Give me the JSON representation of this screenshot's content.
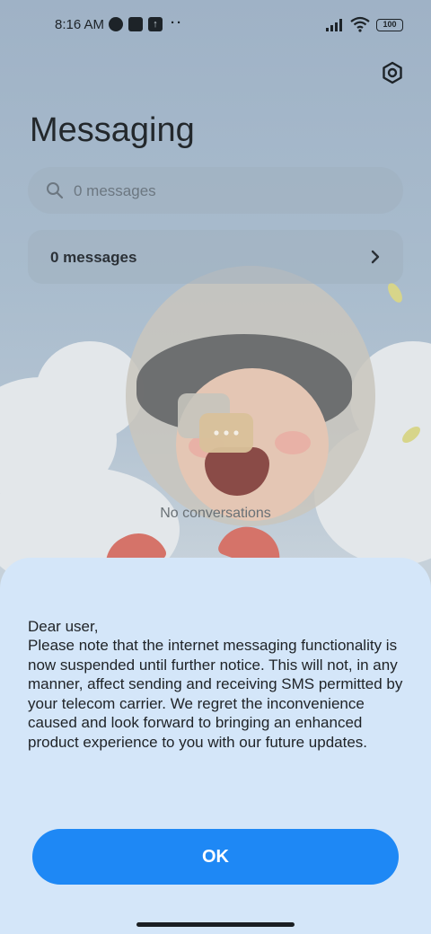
{
  "status_bar": {
    "time": "8:16 AM",
    "dots": "··",
    "battery": "100"
  },
  "header": {
    "title": "Messaging"
  },
  "search": {
    "placeholder": "0 messages"
  },
  "summary": {
    "label": "0 messages"
  },
  "empty_state": {
    "text": "No conversations"
  },
  "dialog": {
    "greeting": "Dear user,",
    "body": "Please note that the internet messaging functionality is now suspended until further notice. This will not, in any manner, affect sending and receiving SMS permitted by your telecom carrier. We regret the inconvenience caused and look forward to bringing an enhanced product experience to you with our future updates.",
    "ok_label": "OK"
  },
  "colors": {
    "accent": "#1e88f5",
    "sheet": "#d4e6f9"
  }
}
